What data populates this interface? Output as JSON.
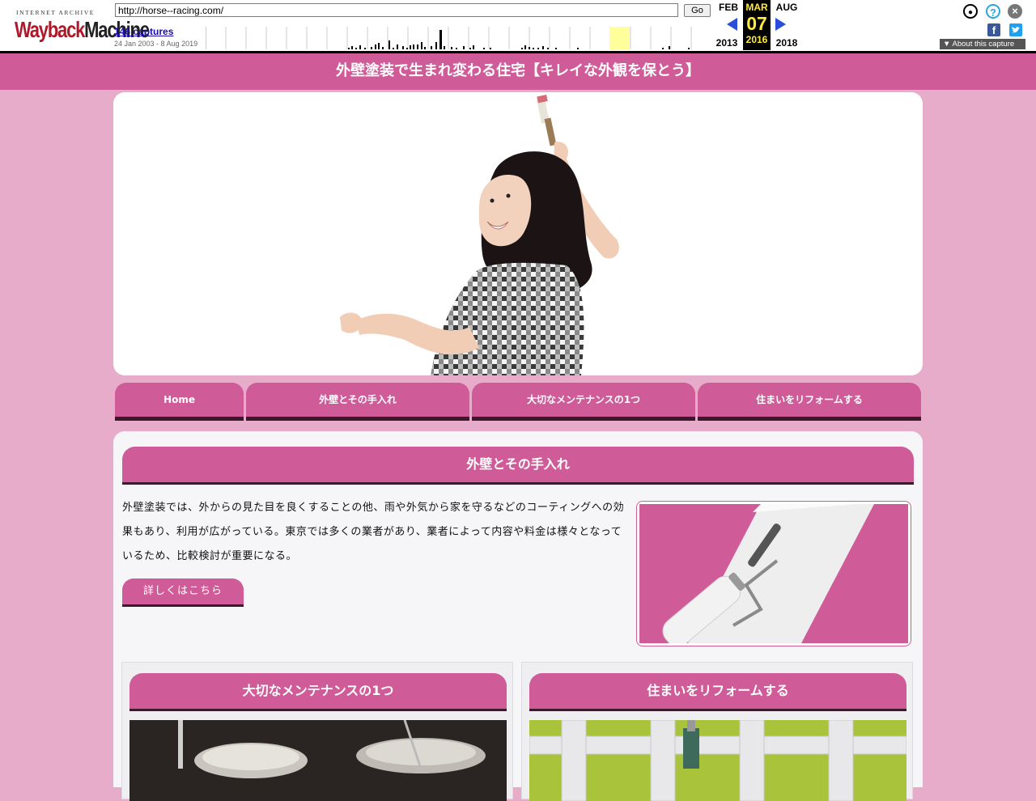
{
  "wayback": {
    "logo_top": "INTERNET ARCHIVE",
    "logo_main_a": "Wayback",
    "logo_main_b": "Machine",
    "url": "http://horse--racing.com/",
    "go_label": "Go",
    "captures": "146 captures",
    "range": "24 Jan 2003 - 8 Aug 2019",
    "prev_month": "FEB",
    "prev_year": "2013",
    "cur_month": "MAR",
    "cur_day": "07",
    "cur_year": "2016",
    "next_month": "AUG",
    "next_year": "2018",
    "about": "About this capture",
    "facebook": "f"
  },
  "site": {
    "header_title": "外壁塗装で生まれ変わる住宅【キレイな外観を保とう】",
    "nav": [
      "Home",
      "外壁とその手入れ",
      "大切なメンテナンスの1つ",
      "住まいをリフォームする"
    ],
    "section1": {
      "title": "外壁とその手入れ",
      "text": "外壁塗装では、外からの見た目を良くすることの他、雨や外気から家を守るなどのコーティングへの効果もあり、利用が広がっている。東京では多くの業者があり、業者によって内容や料金は様々となっているため、比較検討が重要になる。",
      "button": "詳しくはこちら"
    },
    "card1_title": "大切なメンテナンスの1つ",
    "card2_title": "住まいをリフォームする"
  },
  "colors": {
    "page_bg": "#e6acc9",
    "accent": "#cf5c98",
    "content_bg": "#f6f6f8",
    "wayback_link": "#1a0dab",
    "wayback_current": "#ffeb3b"
  },
  "icons": [
    "user-icon",
    "help-icon",
    "close-icon",
    "facebook-icon",
    "twitter-icon",
    "prev-arrow-icon",
    "next-arrow-icon"
  ]
}
